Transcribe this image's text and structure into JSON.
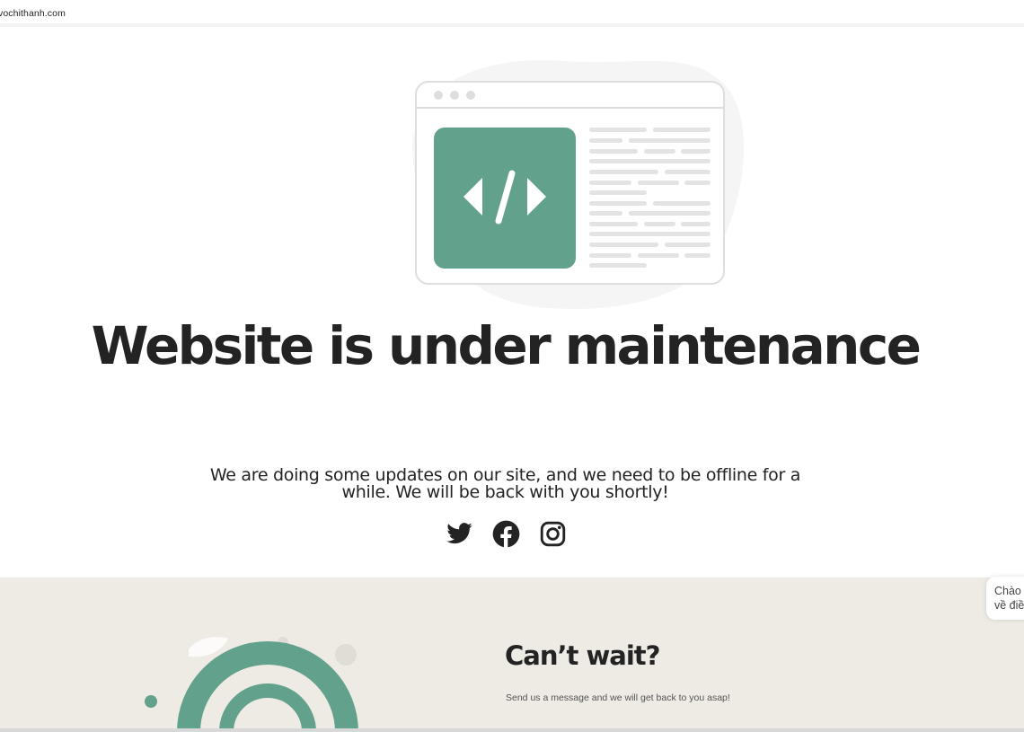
{
  "browser": {
    "url": "vochithanh.com"
  },
  "hero": {
    "title": "Website is under maintenance",
    "subtitle": "We are doing some updates on our site, and we need to be offline for a while. We will be back with you shortly!",
    "illustration_icon": "code-window-icon"
  },
  "social": [
    {
      "name": "twitter-icon"
    },
    {
      "name": "facebook-icon"
    },
    {
      "name": "instagram-icon"
    }
  ],
  "cta": {
    "title": "Can’t wait?",
    "text": "Send us a message and we will get back to you asap!"
  },
  "chat": {
    "line1": "Chào",
    "line2": "về điề"
  },
  "colors": {
    "accent": "#62a18b",
    "text": "#232323",
    "section_bg": "#eeeae4",
    "skeleton": "#e3e3e3"
  }
}
